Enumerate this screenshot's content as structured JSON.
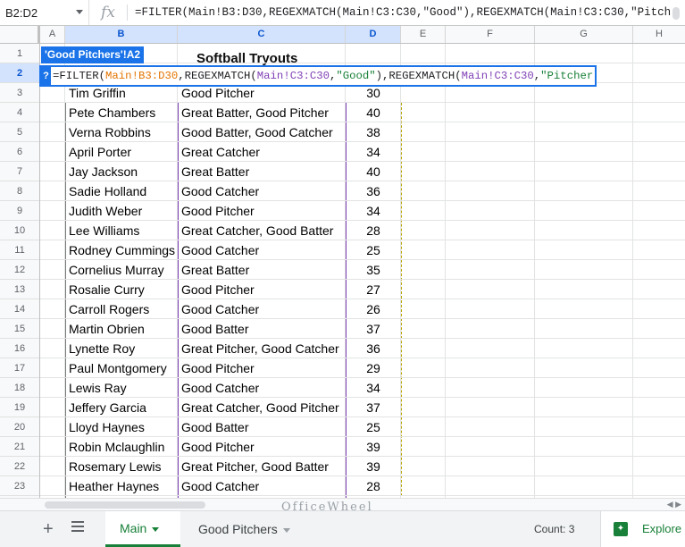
{
  "formula_bar": {
    "name_box": "B2:D2",
    "fx": "fx",
    "formula": "=FILTER(Main!B3:D30,REGEXMATCH(Main!C3:C30,\"Good\"),REGEXMATCH(Main!C3:C30,\"Pitch"
  },
  "columns": [
    "A",
    "B",
    "C",
    "D",
    "E",
    "F",
    "G",
    "H"
  ],
  "rows": [
    "1",
    "2",
    "3",
    "4",
    "5",
    "6",
    "7",
    "8",
    "9",
    "10",
    "11",
    "12",
    "13",
    "14",
    "15",
    "16",
    "17",
    "18",
    "19",
    "20",
    "21",
    "22",
    "23"
  ],
  "sheet_title": "Softball Tryouts",
  "ref_tag": "'Good Pitchers'!A2",
  "editor": {
    "help": "?",
    "parts": {
      "p1": "=FILTER(",
      "r1": "Main!B3:D30",
      "p2": ",REGEXMATCH(",
      "r2": "Main!C3:C30",
      "p3": ",",
      "r3": "\"Good\"",
      "p4": "),REGEXMATCH(",
      "r4": "Main!C3:C30",
      "p5": ",",
      "r5": "\"Pitcher\"",
      "p6": ")"
    }
  },
  "table": [
    {
      "name": "Tim Griffin",
      "skill": "Good Pitcher",
      "score": "30"
    },
    {
      "name": "Pete Chambers",
      "skill": "Great Batter, Good Pitcher",
      "score": "40"
    },
    {
      "name": "Verna Robbins",
      "skill": "Good Batter, Good Catcher",
      "score": "38"
    },
    {
      "name": "April Porter",
      "skill": "Great Catcher",
      "score": "34"
    },
    {
      "name": "Jay Jackson",
      "skill": "Great Batter",
      "score": "40"
    },
    {
      "name": "Sadie Holland",
      "skill": "Good Catcher",
      "score": "36"
    },
    {
      "name": "Judith Weber",
      "skill": "Good Pitcher",
      "score": "34"
    },
    {
      "name": "Lee Williams",
      "skill": "Great Catcher, Good Batter",
      "score": "28"
    },
    {
      "name": "Rodney Cummings",
      "skill": "Good Catcher",
      "score": "25"
    },
    {
      "name": "Cornelius Murray",
      "skill": "Great Batter",
      "score": "35"
    },
    {
      "name": "Rosalie Curry",
      "skill": "Good Pitcher",
      "score": "27"
    },
    {
      "name": "Carroll Rogers",
      "skill": "Good Catcher",
      "score": "26"
    },
    {
      "name": "Martin Obrien",
      "skill": "Good Batter",
      "score": "37"
    },
    {
      "name": "Lynette Roy",
      "skill": "Great Pitcher, Good Catcher",
      "score": "36"
    },
    {
      "name": "Paul Montgomery",
      "skill": "Good Pitcher",
      "score": "29"
    },
    {
      "name": "Lewis Ray",
      "skill": "Good Catcher",
      "score": "34"
    },
    {
      "name": "Jeffery Garcia",
      "skill": "Great Catcher, Good Pitcher",
      "score": "37"
    },
    {
      "name": "Lloyd Haynes",
      "skill": "Good Batter",
      "score": "25"
    },
    {
      "name": "Robin Mclaughlin",
      "skill": "Good Pitcher",
      "score": "39"
    },
    {
      "name": "Rosemary Lewis",
      "skill": "Great Pitcher, Good Batter",
      "score": "39"
    },
    {
      "name": "Heather Haynes",
      "skill": "Good Catcher",
      "score": "28"
    }
  ],
  "tabs": {
    "add": "+",
    "active": "Main",
    "other": "Good Pitchers"
  },
  "status": {
    "count": "Count: 3",
    "explore": "Explore"
  },
  "watermark": "OfficeWheel",
  "colors": {
    "accent": "#1a73e8",
    "active_tab": "#188038",
    "range1": "#e37400",
    "range2": "#7e3fb5",
    "string": "#188038"
  }
}
